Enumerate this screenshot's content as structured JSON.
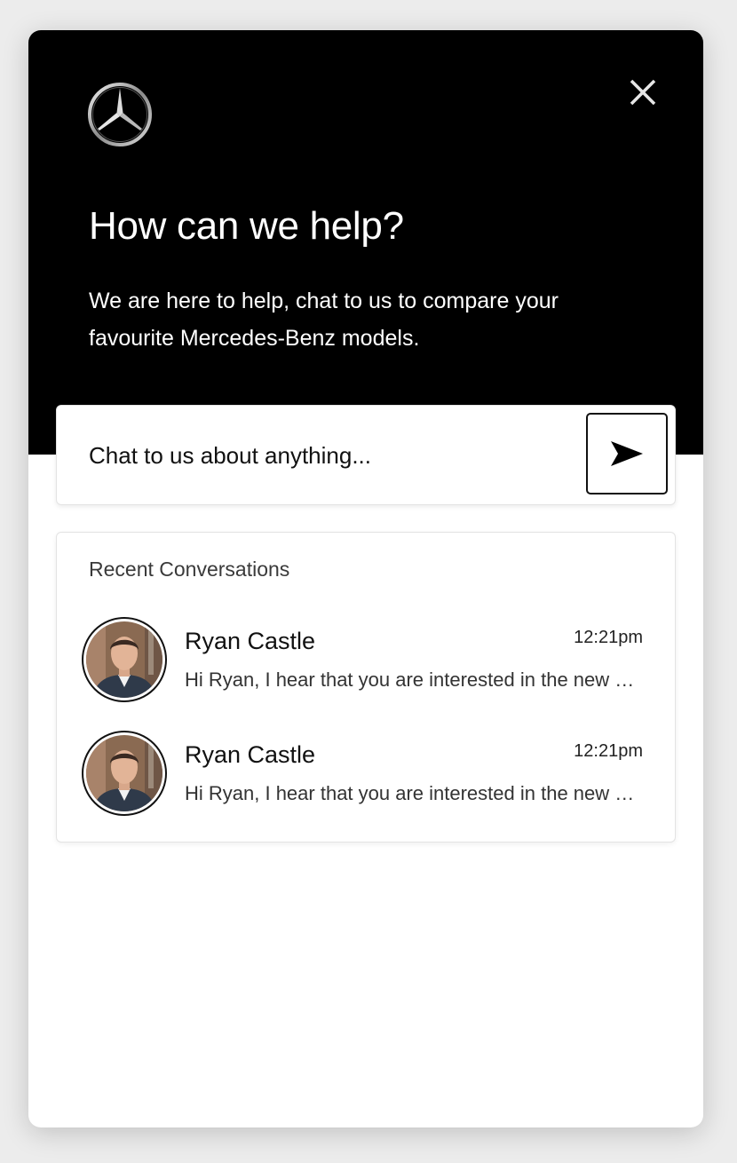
{
  "header": {
    "title": "How can we help?",
    "subtitle": "We are here to help, chat to us to compare your favourite Mercedes-Benz models.",
    "logo_icon": "mercedes-star-logo",
    "close_icon": "close-icon"
  },
  "chat": {
    "placeholder": "Chat to us about anything...",
    "send_icon": "send-arrow-icon"
  },
  "recent": {
    "heading": "Recent Conversations",
    "conversations": [
      {
        "name": "Ryan Castle",
        "time": "12:21pm",
        "preview": "Hi Ryan, I hear that you are interested in the new Mercedes-Benz models"
      },
      {
        "name": "Ryan Castle",
        "time": "12:21pm",
        "preview": "Hi Ryan, I hear that you are interested in the new Mercedes-Benz models"
      }
    ]
  },
  "colors": {
    "header_bg": "#000000",
    "accent": "#111111",
    "panel_bg": "#ffffff"
  }
}
